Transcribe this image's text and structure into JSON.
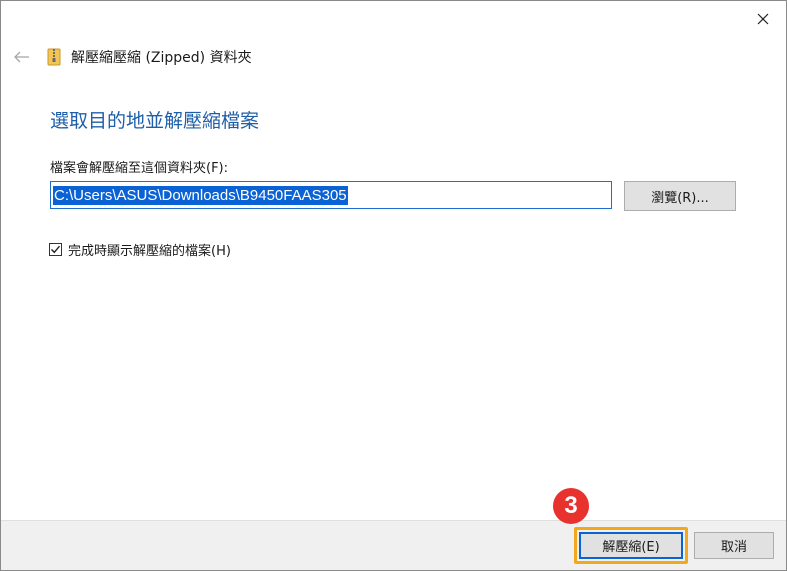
{
  "window": {
    "close_icon": "close-icon",
    "back_icon": "arrow-left-icon",
    "folder_icon": "zip-folder-icon",
    "title": "解壓縮壓縮 (Zipped) 資料夾"
  },
  "dialog": {
    "heading": "選取目的地並解壓縮檔案",
    "path_label": "檔案會解壓縮至這個資料夾(F):",
    "path_value": "C:\\Users\\ASUS\\Downloads\\B9450FAAS305",
    "browse_label": "瀏覽(R)...",
    "checkbox": {
      "label": "完成時顯示解壓縮的檔案(H)",
      "checked": true
    }
  },
  "footer": {
    "extract_label": "解壓縮(E)",
    "cancel_label": "取消"
  },
  "annotation": {
    "step_number": "3",
    "badge_color": "#e8322e",
    "highlight_color": "#f5a71c"
  },
  "colors": {
    "heading": "#1f5fa8",
    "selection": "#0a62d4"
  }
}
